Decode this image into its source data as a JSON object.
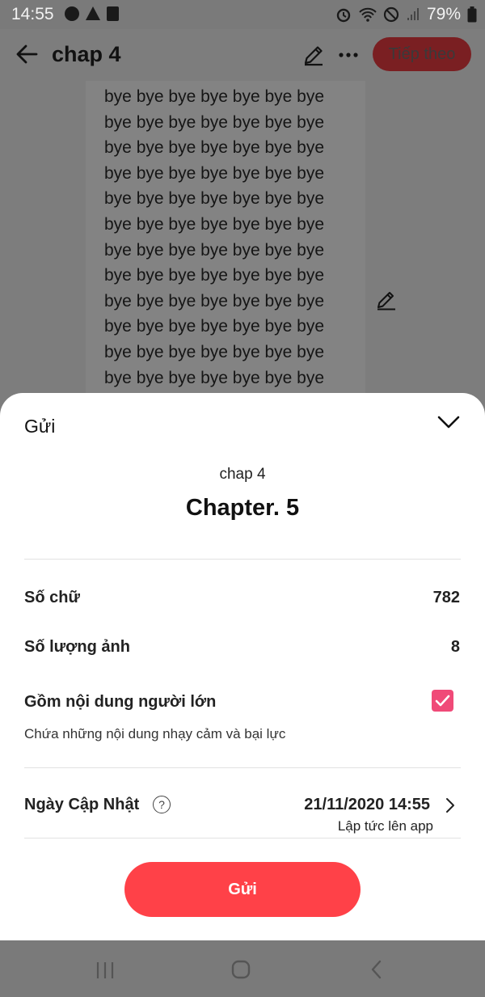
{
  "status_bar": {
    "time": "14:55",
    "battery": "79%"
  },
  "app_bar": {
    "title": "chap 4",
    "next_label": "Tiếp theo"
  },
  "editor": {
    "lines": [
      "bye bye bye bye bye bye bye",
      "bye bye bye bye bye bye bye",
      "bye bye bye bye bye bye bye",
      "bye bye bye bye bye bye bye",
      "bye bye bye bye bye bye bye",
      "bye bye bye bye bye bye bye",
      "bye bye bye bye bye bye bye",
      "bye bye bye bye bye bye bye",
      "bye bye bye bye bye bye bye",
      "bye bye bye bye bye bye bye",
      "bye bye bye bye bye bye bye",
      "bye bye bye bye bye bye bye"
    ]
  },
  "sheet": {
    "title": "Gửi",
    "story_name": "chap 4",
    "chapter_name": "Chapter. 5",
    "word_count_label": "Số chữ",
    "word_count_value": "782",
    "image_count_label": "Số lượng ảnh",
    "image_count_value": "8",
    "adult_label": "Gồm nội dung người lớn",
    "adult_checked": true,
    "adult_note": "Chứa những nội dung nhạy cảm và bại lực",
    "update_label": "Ngày Cập Nhật",
    "help_symbol": "?",
    "update_date": "21/11/2020 14:55",
    "update_sub": "Lập tức lên app",
    "send_label": "Gửi"
  },
  "colors": {
    "accent": "#ff4148",
    "checkbox": "#f04a78",
    "next_button": "#7a1f22"
  }
}
